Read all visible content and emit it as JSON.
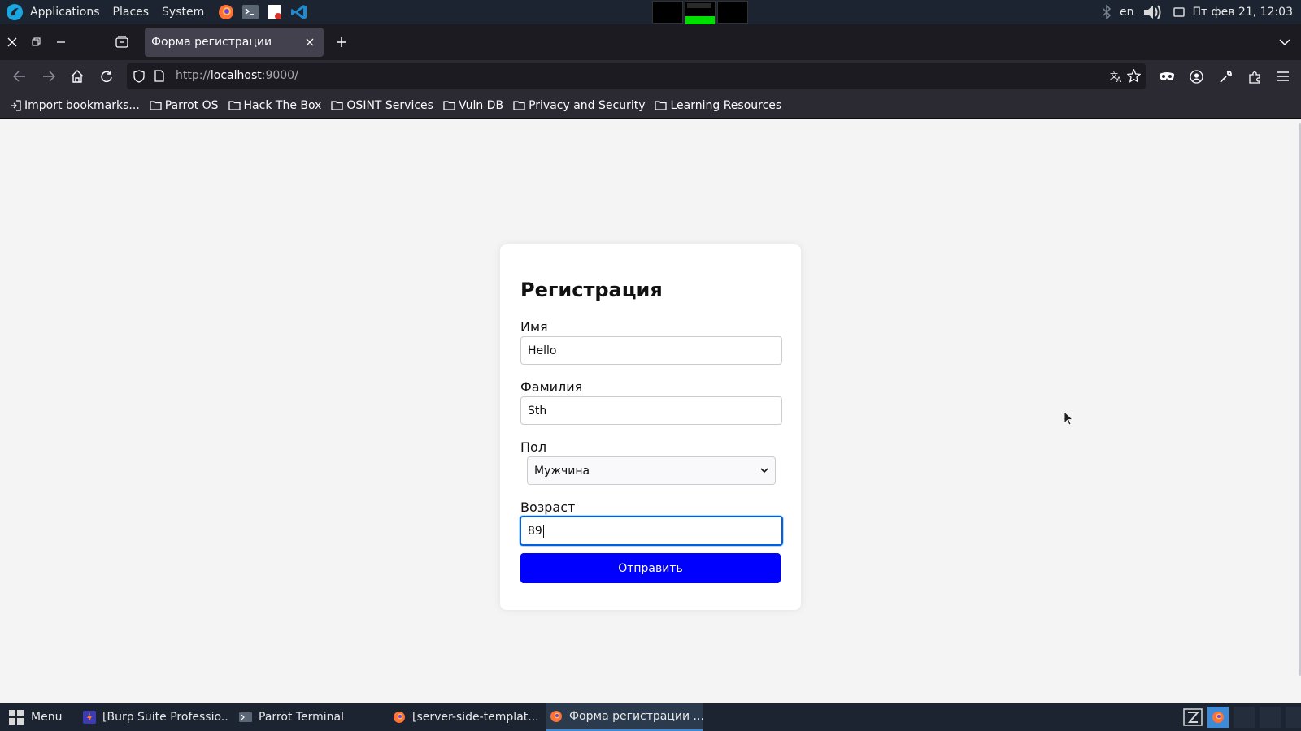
{
  "system_panel": {
    "menus": [
      "Applications",
      "Places",
      "System"
    ],
    "language": "en",
    "datetime": "Пт фев 21, 12:03"
  },
  "browser": {
    "tab_title": "Форма регистрации",
    "url_scheme": "http://",
    "url_host": "localhost",
    "url_rest": ":9000/",
    "bookmarks": [
      "Import bookmarks...",
      "Parrot OS",
      "Hack The Box",
      "OSINT Services",
      "Vuln DB",
      "Privacy and Security",
      "Learning Resources"
    ]
  },
  "form": {
    "title": "Регистрация",
    "first_name_label": "Имя",
    "first_name_value": "Hello",
    "last_name_label": "Фамилия",
    "last_name_value": "Sth",
    "gender_label": "Пол",
    "gender_value": "Мужчина",
    "age_label": "Возраст",
    "age_value": "89",
    "submit_label": "Отправить"
  },
  "taskbar": {
    "menu_label": "Menu",
    "tasks": [
      "[Burp Suite Professio...",
      "Parrot Terminal",
      "[server-side-templat...",
      "Форма регистрации ..."
    ]
  },
  "colors": {
    "submit_bg": "#0000ff",
    "focus_ring": "#0060df",
    "panel_bg": "#1b2430"
  }
}
